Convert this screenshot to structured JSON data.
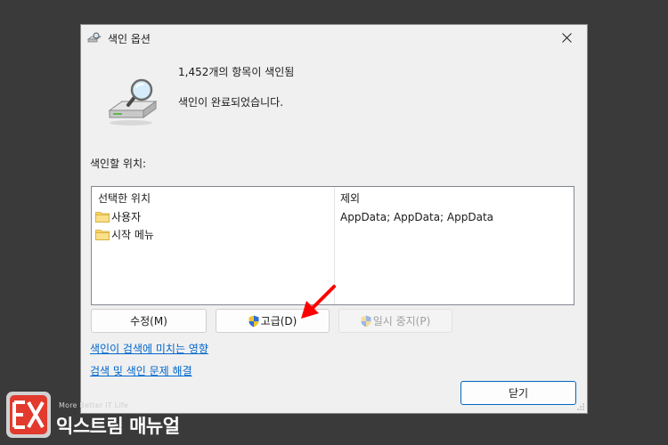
{
  "window": {
    "title": "색인 옵션",
    "close_label": "×"
  },
  "summary": {
    "count_text": "1,452개의 항목이 색인됨",
    "status_text": "색인이 완료되었습니다."
  },
  "locations": {
    "section_label": "색인할 위치:",
    "columns": {
      "included": "선택한 위치",
      "excluded": "제외"
    },
    "items": [
      {
        "name": "사용자",
        "excluded": "AppData; AppData; AppData"
      },
      {
        "name": "시작 메뉴",
        "excluded": ""
      }
    ]
  },
  "buttons": {
    "modify": "수정(M)",
    "advanced": "고급(D)",
    "pause": "일시 중지(P)",
    "close": "닫기"
  },
  "links": {
    "how_indexing_affects": "색인이 검색에 미치는 영향",
    "troubleshoot": "검색 및 색인 문제 해결"
  },
  "watermark": {
    "tagline": "More Better IT Life",
    "brand": "익스트림 매뉴얼"
  },
  "colors": {
    "accent": "#0067c0",
    "link": "#0066cc",
    "annotation_arrow": "#ff0000"
  }
}
